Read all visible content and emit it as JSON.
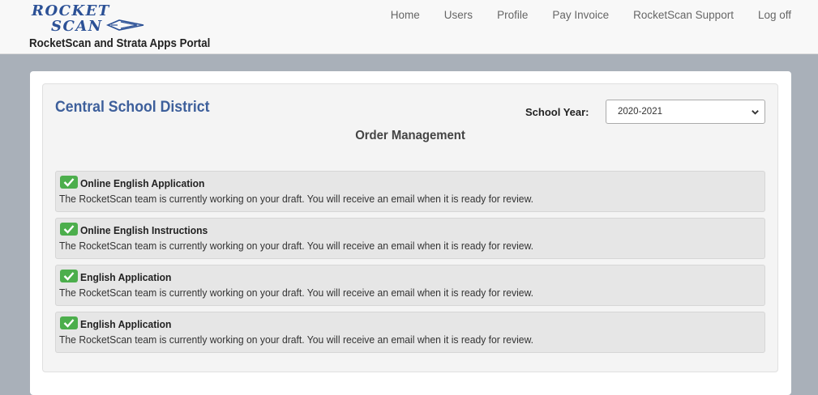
{
  "header": {
    "logo_line1": "ROCKET",
    "logo_line2": "SCAN",
    "portal_title": "RocketScan and Strata Apps Portal",
    "nav": [
      "Home",
      "Users",
      "Profile",
      "Pay Invoice",
      "RocketScan Support",
      "Log off"
    ]
  },
  "main": {
    "district": "Central School District",
    "school_year_label": "School Year:",
    "school_year_value": "2020-2021",
    "heading": "Order Management",
    "orders": [
      {
        "title": "Online English Application",
        "message": "The RocketScan team is currently working on your draft. You will receive an email when it is ready for review.",
        "icon": "check-icon"
      },
      {
        "title": "Online English Instructions",
        "message": "The RocketScan team is currently working on your draft. You will receive an email when it is ready for review.",
        "icon": "check-icon"
      },
      {
        "title": "English Application",
        "message": "The RocketScan team is currently working on your draft. You will receive an email when it is ready for review.",
        "icon": "check-icon"
      },
      {
        "title": "English Application",
        "message": "The RocketScan team is currently working on your draft. You will receive an email when it is ready for review.",
        "icon": "check-icon"
      }
    ]
  },
  "colors": {
    "brand": "#3d5f9b",
    "success": "#4cae4c",
    "page_bg": "#a9b0b9"
  }
}
